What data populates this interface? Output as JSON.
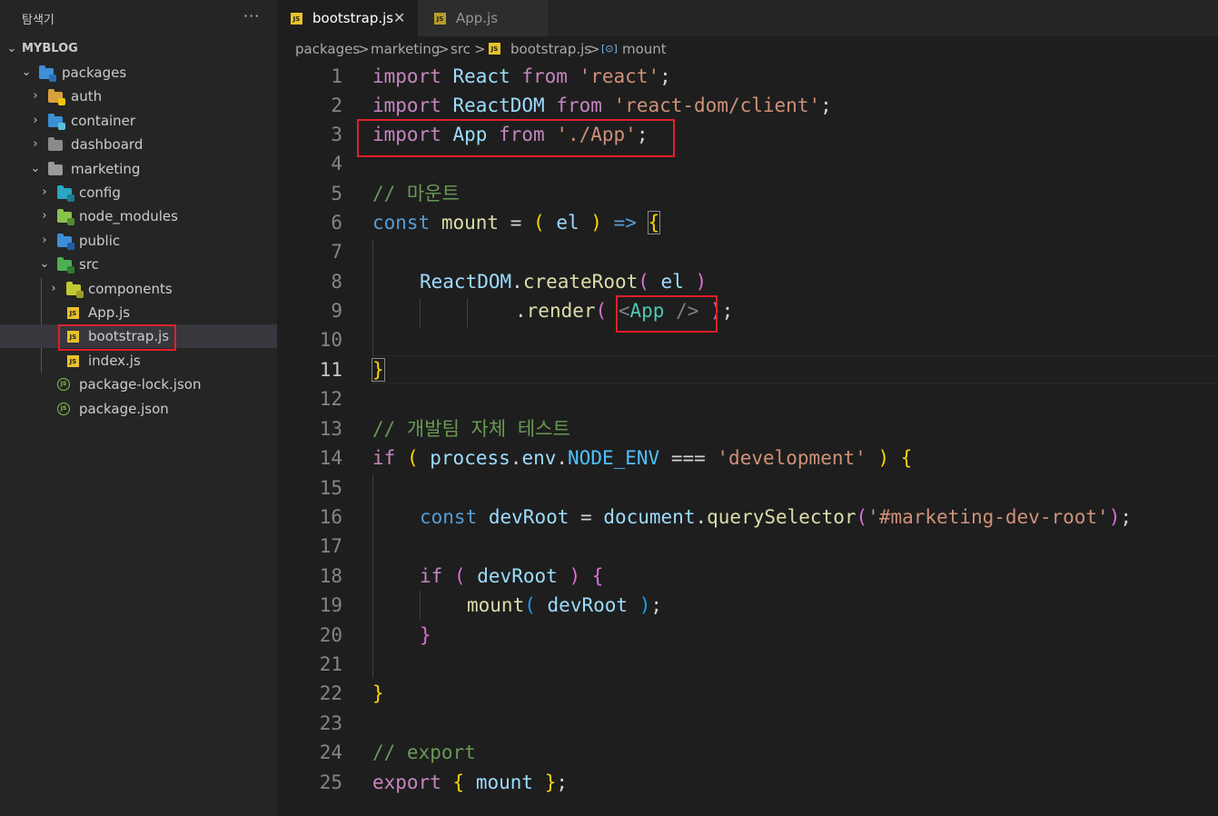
{
  "sidebar": {
    "title": "탐색기",
    "more": "···",
    "project": "MYBLOG",
    "items": [
      {
        "label": "packages",
        "chevron": "v"
      },
      {
        "label": "auth",
        "chevron": ">"
      },
      {
        "label": "container",
        "chevron": ">"
      },
      {
        "label": "dashboard",
        "chevron": ">"
      },
      {
        "label": "marketing",
        "chevron": "v"
      },
      {
        "label": "config",
        "chevron": ">"
      },
      {
        "label": "node_modules",
        "chevron": ">"
      },
      {
        "label": "public",
        "chevron": ">"
      },
      {
        "label": "src",
        "chevron": "v"
      },
      {
        "label": "components",
        "chevron": ">"
      },
      {
        "label": "App.js",
        "chevron": ""
      },
      {
        "label": "bootstrap.js",
        "chevron": ""
      },
      {
        "label": "index.js",
        "chevron": ""
      },
      {
        "label": "package-lock.json",
        "chevron": ""
      },
      {
        "label": "package.json",
        "chevron": ""
      }
    ]
  },
  "tabs": [
    {
      "label": "bootstrap.js",
      "close": "✕"
    },
    {
      "label": "App.js"
    }
  ],
  "icons": {
    "js": "JS",
    "json": "JS"
  },
  "breadcrumb": {
    "items": [
      "packages",
      "marketing",
      "src",
      "bootstrap.js",
      "mount"
    ],
    "separator": ">",
    "symbol": "[⊙]"
  },
  "editor": {
    "active_line": 11,
    "line_numbers": [
      "1",
      "2",
      "3",
      "4",
      "5",
      "6",
      "7",
      "8",
      "9",
      "10",
      "11",
      "12",
      "13",
      "14",
      "15",
      "16",
      "17",
      "18",
      "19",
      "20",
      "21",
      "22",
      "23",
      "24",
      "25"
    ],
    "lines": {
      "l1": [
        "import",
        " React ",
        "from",
        " ",
        "'react'",
        ";"
      ],
      "l2": [
        "import",
        " ReactDOM ",
        "from",
        " ",
        "'react-dom/client'",
        ";"
      ],
      "l3": [
        "import",
        " App ",
        "from",
        " ",
        "'./App'",
        ";"
      ],
      "l5": "// 마운트",
      "l6": [
        "const",
        " mount ",
        "=",
        " ",
        "(",
        " el ",
        ")",
        " ",
        "=>",
        " ",
        "{"
      ],
      "l8": [
        "ReactDOM",
        ".",
        "createRoot",
        "(",
        " el ",
        ")"
      ],
      "l9": [
        ".",
        "render",
        "(",
        " ",
        "<",
        "App",
        " />",
        " ",
        ")",
        ";"
      ],
      "l11": "}",
      "l13": "// 개발팀 자체 테스트",
      "l14": [
        "if",
        " ",
        "(",
        " ",
        "process",
        ".",
        "env",
        ".",
        "NODE_ENV",
        " === ",
        "'development'",
        " ",
        ")",
        " ",
        "{"
      ],
      "l16": [
        "const",
        " ",
        "devRoot",
        " = ",
        "document",
        ".",
        "querySelector",
        "(",
        "'#marketing-dev-root'",
        ")",
        ";"
      ],
      "l18": [
        "if",
        " ",
        "(",
        " ",
        "devRoot",
        " ",
        ")",
        " ",
        "{"
      ],
      "l19": [
        "mount",
        "(",
        " ",
        "devRoot",
        " ",
        ")",
        ";"
      ],
      "l20": "}",
      "l22": "}",
      "l24": "// export",
      "l25": [
        "export",
        " ",
        "{",
        " mount ",
        "}",
        ";"
      ]
    }
  },
  "colors": {
    "highlight_box": "#e0202a",
    "keyword": "#569cd6",
    "string": "#ce9178",
    "comment": "#6a9955"
  }
}
